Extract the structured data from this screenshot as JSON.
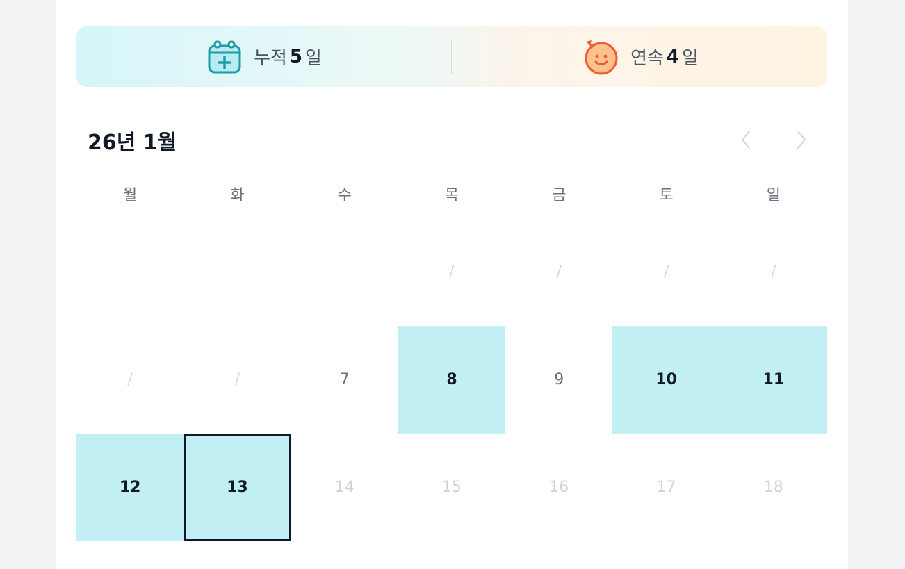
{
  "stats": {
    "total": {
      "prefix": "누적",
      "value": "5",
      "suffix": "일"
    },
    "streak": {
      "prefix": "연속",
      "value": "4",
      "suffix": "일"
    }
  },
  "calendar": {
    "title": "26년 1월",
    "weekdays": [
      "월",
      "화",
      "수",
      "목",
      "금",
      "토",
      "일"
    ],
    "cells": [
      {
        "label": "",
        "state": "blank"
      },
      {
        "label": "",
        "state": "blank"
      },
      {
        "label": "",
        "state": "blank"
      },
      {
        "label": "/",
        "state": "empty"
      },
      {
        "label": "/",
        "state": "empty"
      },
      {
        "label": "/",
        "state": "empty"
      },
      {
        "label": "/",
        "state": "empty"
      },
      {
        "label": "/",
        "state": "empty"
      },
      {
        "label": "/",
        "state": "empty"
      },
      {
        "label": "7",
        "state": "normal"
      },
      {
        "label": "8",
        "state": "done"
      },
      {
        "label": "9",
        "state": "normal"
      },
      {
        "label": "10",
        "state": "done"
      },
      {
        "label": "11",
        "state": "done"
      },
      {
        "label": "12",
        "state": "done"
      },
      {
        "label": "13",
        "state": "done today"
      },
      {
        "label": "14",
        "state": "future"
      },
      {
        "label": "15",
        "state": "future"
      },
      {
        "label": "16",
        "state": "future"
      },
      {
        "label": "17",
        "state": "future"
      },
      {
        "label": "18",
        "state": "future"
      }
    ]
  },
  "icons": {
    "total": "calendar-plus-icon",
    "streak": "smiley-sun-icon",
    "prev": "chevron-left-icon",
    "next": "chevron-right-icon"
  },
  "colors": {
    "done": "#c2eff4",
    "today_border": "#111827",
    "calendar_icon": "#1f9aa8",
    "smiley": "#ee5a3b"
  }
}
